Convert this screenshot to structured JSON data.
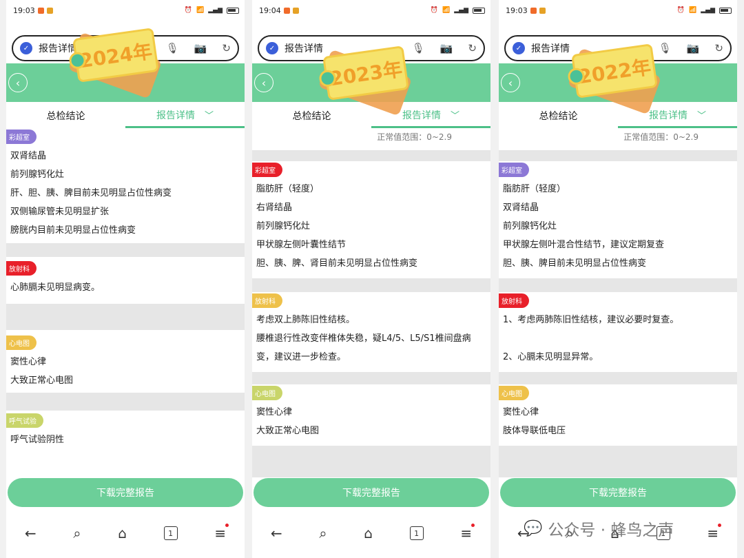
{
  "phones": [
    {
      "time": "19:03",
      "url": "报告详情",
      "year_tag": "2024年",
      "tabs": [
        "总检结论",
        "报告详情"
      ],
      "range": "",
      "sections": [
        {
          "badge": "彩超室",
          "color": "#8c78d6",
          "lines": [
            "双肾结晶",
            "前列腺钙化灶",
            "肝、胆、胰、脾目前未见明显占位性病变",
            "双侧输尿管未见明显扩张",
            "膀胱内目前未见明显占位性病变"
          ]
        },
        {
          "badge": "放射科",
          "color": "#e8202a",
          "lines": [
            "心肺膈未见明显病变。"
          ]
        },
        {
          "badge": "心电图",
          "color": "#eec14a",
          "lines": [
            "窦性心律",
            "大致正常心电图"
          ]
        },
        {
          "badge": "呼气试验",
          "color": "#c9d56a",
          "lines": [
            "呼气试验阴性"
          ]
        }
      ],
      "download": "下载完整报告",
      "tab_count": "1"
    },
    {
      "time": "19:04",
      "url": "报告详情",
      "year_tag": "2023年",
      "tabs": [
        "总检结论",
        "报告详情"
      ],
      "range": "正常值范围：0~2.9",
      "sections": [
        {
          "badge": "彩超室",
          "color": "#e8202a",
          "lines": [
            "脂肪肝（轻度）",
            "右肾结晶",
            "前列腺钙化灶",
            "甲状腺左侧叶囊性结节",
            "胆、胰、脾、肾目前未见明显占位性病变"
          ]
        },
        {
          "badge": "放射科",
          "color": "#eec14a",
          "lines": [
            "考虑双上肺陈旧性结核。",
            "腰椎退行性改变伴椎体失稳，疑L4/5、L5/S1椎间盘病",
            "变，建议进一步检查。"
          ]
        },
        {
          "badge": "心电图",
          "color": "#c9d56a",
          "lines": [
            "窦性心律",
            "大致正常心电图"
          ]
        }
      ],
      "download": "下载完整报告",
      "tab_count": "1"
    },
    {
      "time": "19:03",
      "url": "报告详情",
      "year_tag": "2022年",
      "tabs": [
        "总检结论",
        "报告详情"
      ],
      "range": "正常值范围：0~2.9",
      "sections": [
        {
          "badge": "彩超室",
          "color": "#8c78d6",
          "lines": [
            "脂肪肝（轻度）",
            "双肾结晶",
            "前列腺钙化灶",
            "甲状腺左侧叶混合性结节，建议定期复查",
            "胆、胰、脾目前未见明显占位性病变"
          ]
        },
        {
          "badge": "放射科",
          "color": "#e8202a",
          "lines": [
            "1、考虑两肺陈旧性结核，建议必要时复查。",
            "",
            "2、心膈未见明显异常。"
          ]
        },
        {
          "badge": "心电图",
          "color": "#eec14a",
          "lines": [
            "窦性心律",
            "肢体导联低电压"
          ]
        }
      ],
      "download": "下载完整报告",
      "tab_count": "1"
    }
  ],
  "watermark": "公众号 · 蜂鸟之声",
  "icons": [
    "back-arrow-icon",
    "search-icon",
    "home-icon",
    "tabs-icon",
    "menu-icon",
    "mic-icon",
    "camera-icon",
    "refresh-icon"
  ]
}
